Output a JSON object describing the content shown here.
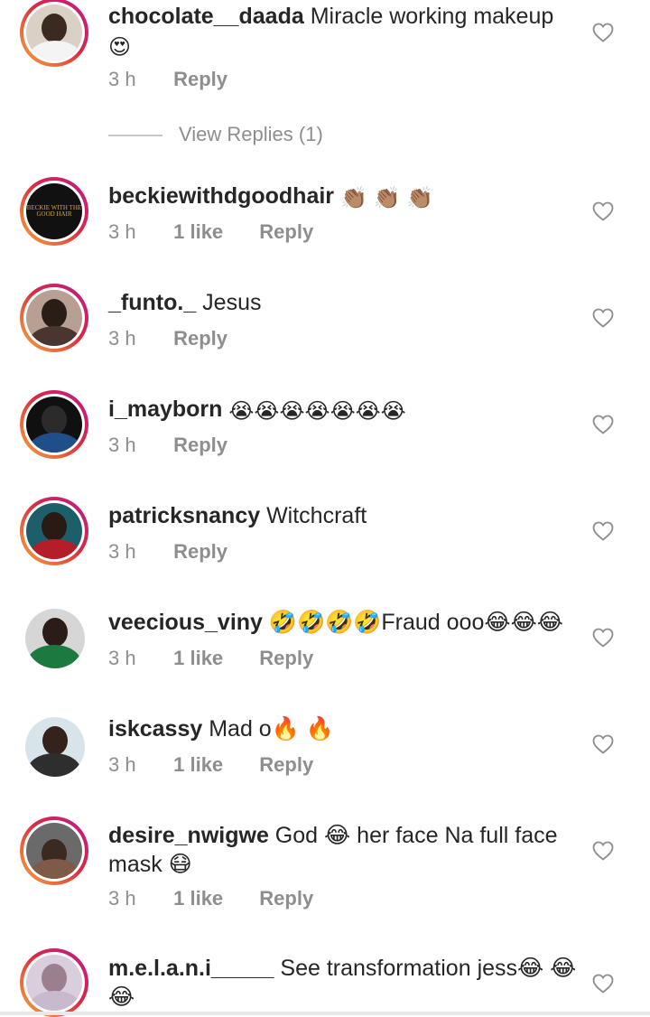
{
  "comments": [
    {
      "username": "chocolate__daada",
      "text": " Miracle working makeup",
      "emoji_trailing": "😍",
      "time": "3 h",
      "likes": "",
      "reply": "Reply"
    },
    {
      "username": "beckiewithdgoodhair",
      "text": " ",
      "emoji_trailing": "👏🏽 👏🏽 👏🏽",
      "time": "3 h",
      "likes": "1 like",
      "reply": "Reply",
      "avatar_text": "BECKIE WITH THE GOOD HAIR"
    },
    {
      "username": "_funto._",
      "text": " Jesus",
      "emoji_trailing": "",
      "time": "3 h",
      "likes": "",
      "reply": "Reply"
    },
    {
      "username": "i_mayborn",
      "text": " ",
      "emoji_trailing": "😭😭😭😭😭😭😭",
      "time": "3 h",
      "likes": "",
      "reply": "Reply"
    },
    {
      "username": "patricksnancy",
      "text": " Witchcraft",
      "emoji_trailing": "",
      "time": "3 h",
      "likes": "",
      "reply": "Reply"
    },
    {
      "username": "veecious_viny",
      "text": " 🤣🤣🤣🤣Fraud ooo😂😂😂",
      "emoji_trailing": "",
      "time": "3 h",
      "likes": "1 like",
      "reply": "Reply"
    },
    {
      "username": "iskcassy",
      "text": " Mad o🔥 🔥",
      "emoji_trailing": "",
      "time": "3 h",
      "likes": "1 like",
      "reply": "Reply"
    },
    {
      "username": "desire_nwigwe",
      "text": " God 😂 her face Na full face mask 😷",
      "emoji_trailing": "",
      "time": "3 h",
      "likes": "1 like",
      "reply": "Reply"
    },
    {
      "username": "m.e.l.a.n.i_____",
      "text": " See transformation jess😂 😂😂",
      "emoji_trailing": "",
      "time": "",
      "likes": "",
      "reply": ""
    }
  ],
  "view_replies": "View Replies (1)",
  "colors": {
    "username": "#262626",
    "meta": "#8e8e8e",
    "story_ring": "#dc2743"
  },
  "icons": {
    "like": "heart-outline-icon"
  }
}
